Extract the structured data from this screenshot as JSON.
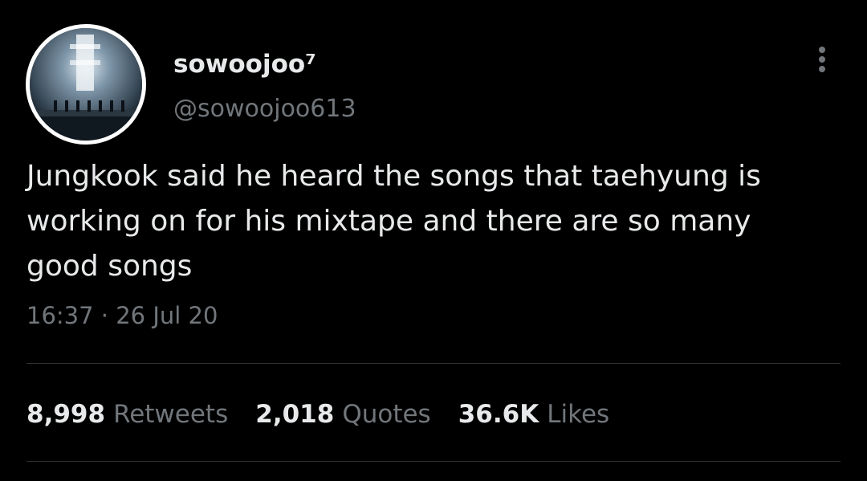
{
  "user": {
    "display_name": "sowoojoo⁷",
    "handle": "@sowoojoo613"
  },
  "tweet": {
    "text": "Jungkook said he heard the songs that taehyung is\nworking on for his mixtape and there are so many\ngood songs",
    "timestamp": "16:37 · 26 Jul 20"
  },
  "stats": [
    {
      "number": "8,998",
      "label": "Retweets"
    },
    {
      "number": "2,018",
      "label": "Quotes"
    },
    {
      "number": "36.6K",
      "label": "Likes"
    }
  ],
  "icons": {
    "menu": "more-vertical-icon"
  },
  "colors": {
    "background": "#000000",
    "primary_text": "#e7e9ea",
    "secondary_text": "#71767b",
    "divider": "#2f3336"
  }
}
